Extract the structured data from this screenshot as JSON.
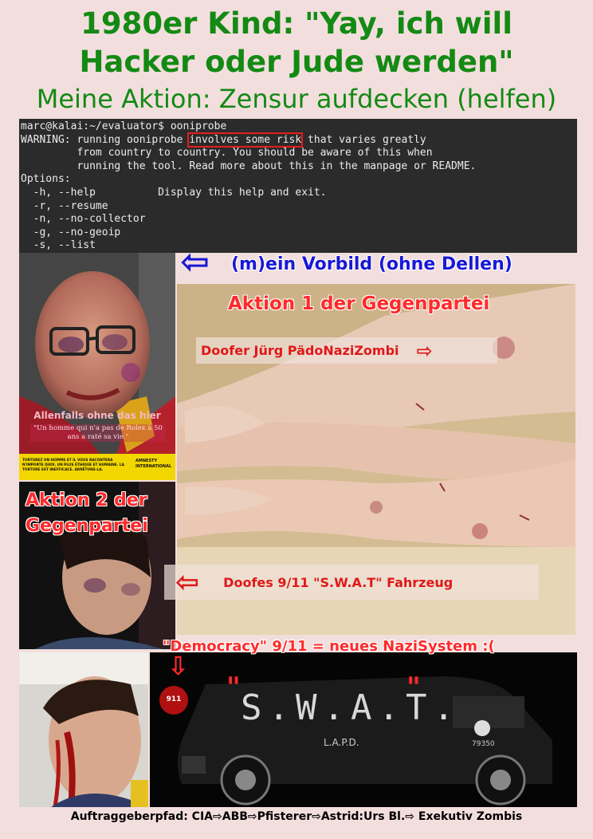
{
  "title": {
    "line1": "1980er Kind: \"Yay, ich will",
    "line2": "Hacker oder Jude werden\"",
    "subtitle": "Meine Aktion: Zensur aufdecken (helfen)"
  },
  "terminal": {
    "prompt": "marc@kalai:~/evaluator$ ooniprobe",
    "warning_pre": "WARNING: running ooniprobe ",
    "warning_highlight": "involves some risk",
    "warning_post": " that varies greatly",
    "line3": "         from country to country. You should be aware of this when",
    "line4": "         running the tool. Read more about this in the manpage or README.",
    "options_header": "Options:",
    "opt1": "  -h, --help          Display this help and exit.",
    "opt2": "  -r, --resume",
    "opt3": "  -n, --no-collector",
    "opt4": "  -g, --no-geoip",
    "opt5": "  -s, --list"
  },
  "vorbild": {
    "arrow": "⇦",
    "text": "(m)ein Vorbild (ohne Dellen)"
  },
  "aktion1": {
    "heading": "Aktion 1 der Gegenpartei",
    "label": "Doofer Jürg PädoNaziZombi",
    "arrow": "⇨"
  },
  "amnesty": {
    "caption": "Allenfalls ohne das hier",
    "quote": "\"Un homme qui n'a pas de Rolex à 50 ans a raté sa vie.\"",
    "banner": "TORTUREZ UN HOMME ET IL VOUS RACONTERA N'IMPORTE QUOI. UN PLUS ÉTHIQUE ET HUMAINE. LA TORTURE EST INEFFICACE. ARRÊTONS-LA.",
    "brand": "AMNESTY INTERNATIONAL"
  },
  "aktion2": {
    "heading_line1": "Aktion 2 der",
    "heading_line2": "Gegenpartei"
  },
  "swat_label": {
    "arrow": "⇦",
    "text": "Doofes 9/11 \"S.W.A.T\" Fahrzeug"
  },
  "democracy": {
    "text": "\"Democracy\" 9/11 = neues NaziSystem :(",
    "arrow": "⇩"
  },
  "van": {
    "lettering": "S.W.A.T.",
    "quote_left": "\"",
    "quote_right": "\"",
    "dept": "L.A.P.D.",
    "number": "79350",
    "badge": "911"
  },
  "footer": {
    "text": "Auftraggeberpfad: CIA⇨ABB⇨Pfisterer⇨Astrid:Urs Bl.⇨ Exekutiv Zombis"
  },
  "colors": {
    "background": "#f3dede",
    "title_green": "#138a13",
    "warning_red": "#ff2a2a",
    "vorbild_blue": "#1818d6"
  }
}
